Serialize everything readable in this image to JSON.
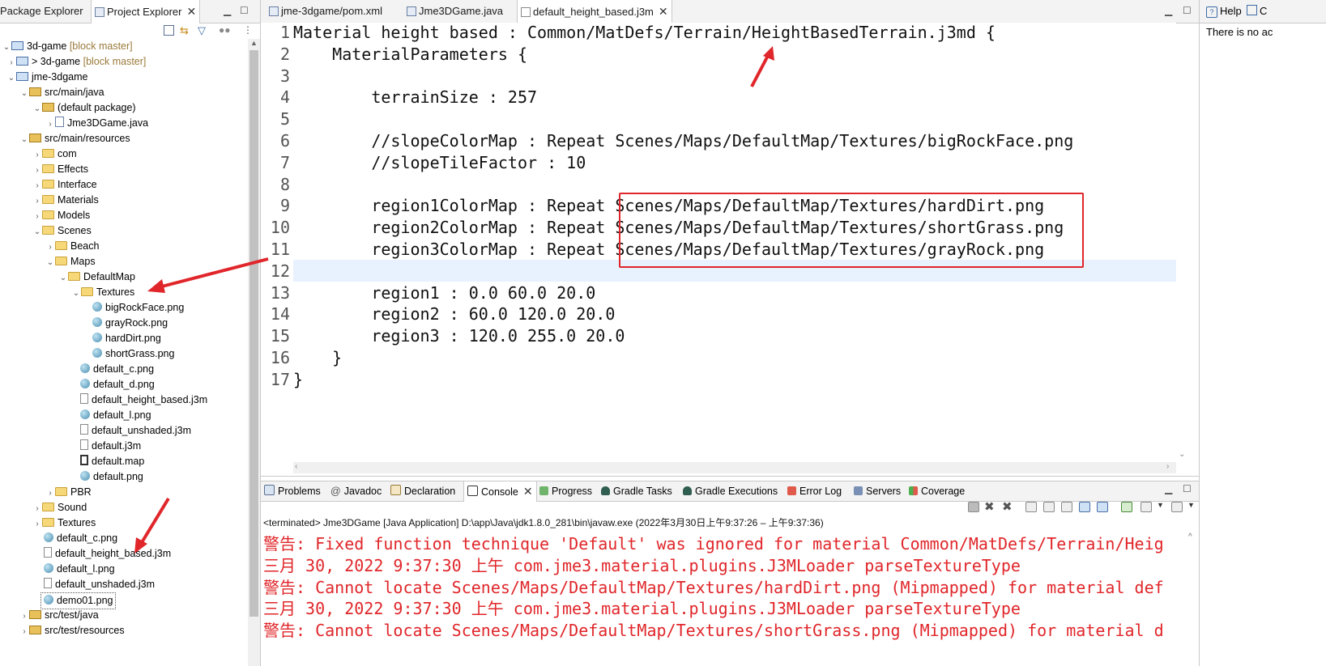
{
  "left_tabs": {
    "package_explorer": "Package Explorer",
    "project_explorer": "Project Explorer"
  },
  "editor_tabs": [
    {
      "label": "jme-3dgame/pom.xml"
    },
    {
      "label": "Jme3DGame.java"
    },
    {
      "label": "default_height_based.j3m"
    }
  ],
  "right_panel": {
    "tab": "Help",
    "tab2": "C",
    "text": "There is no ac"
  },
  "tree": [
    {
      "label": "3d-game",
      "deco": "[block master]"
    },
    {
      "label": "> 3d-game",
      "deco": "[block master]"
    },
    {
      "label": "jme-3dgame",
      "deco": ""
    },
    {
      "label": "src/main/java",
      "deco": ""
    },
    {
      "label": "(default package)",
      "deco": ""
    },
    {
      "label": "Jme3DGame.java",
      "deco": ""
    },
    {
      "label": "src/main/resources",
      "deco": ""
    },
    {
      "label": "com",
      "deco": ""
    },
    {
      "label": "Effects",
      "deco": ""
    },
    {
      "label": "Interface",
      "deco": ""
    },
    {
      "label": "Materials",
      "deco": ""
    },
    {
      "label": "Models",
      "deco": ""
    },
    {
      "label": "Scenes",
      "deco": ""
    },
    {
      "label": "Beach",
      "deco": ""
    },
    {
      "label": "Maps",
      "deco": ""
    },
    {
      "label": "DefaultMap",
      "deco": ""
    },
    {
      "label": "Textures",
      "deco": ""
    },
    {
      "label": "bigRockFace.png",
      "deco": ""
    },
    {
      "label": "grayRock.png",
      "deco": ""
    },
    {
      "label": "hardDirt.png",
      "deco": ""
    },
    {
      "label": "shortGrass.png",
      "deco": ""
    },
    {
      "label": "default_c.png",
      "deco": ""
    },
    {
      "label": "default_d.png",
      "deco": ""
    },
    {
      "label": "default_height_based.j3m",
      "deco": ""
    },
    {
      "label": "default_l.png",
      "deco": ""
    },
    {
      "label": "default_unshaded.j3m",
      "deco": ""
    },
    {
      "label": "default.j3m",
      "deco": ""
    },
    {
      "label": "default.map",
      "deco": ""
    },
    {
      "label": "default.png",
      "deco": ""
    },
    {
      "label": "PBR",
      "deco": ""
    },
    {
      "label": "Sound",
      "deco": ""
    },
    {
      "label": "Textures",
      "deco": ""
    },
    {
      "label": "default_c.png",
      "deco": ""
    },
    {
      "label": "default_height_based.j3m",
      "deco": ""
    },
    {
      "label": "default_l.png",
      "deco": ""
    },
    {
      "label": "default_unshaded.j3m",
      "deco": ""
    },
    {
      "label": "demo01.png",
      "deco": ""
    },
    {
      "label": "src/test/java",
      "deco": ""
    },
    {
      "label": "src/test/resources",
      "deco": ""
    }
  ],
  "code_lines": [
    {
      "n": "1",
      "text": "Material height based : Common/MatDefs/Terrain/HeightBasedTerrain.j3md {"
    },
    {
      "n": "2",
      "text": "    MaterialParameters {"
    },
    {
      "n": "3",
      "text": ""
    },
    {
      "n": "4",
      "text": "        terrainSize : 257"
    },
    {
      "n": "5",
      "text": ""
    },
    {
      "n": "6",
      "text": "        //slopeColorMap : Repeat Scenes/Maps/DefaultMap/Textures/bigRockFace.png"
    },
    {
      "n": "7",
      "text": "        //slopeTileFactor : 10"
    },
    {
      "n": "8",
      "text": ""
    },
    {
      "n": "9",
      "text": "        region1ColorMap : Repeat Scenes/Maps/DefaultMap/Textures/hardDirt.png"
    },
    {
      "n": "10",
      "text": "        region2ColorMap : Repeat Scenes/Maps/DefaultMap/Textures/shortGrass.png"
    },
    {
      "n": "11",
      "text": "        region3ColorMap : Repeat Scenes/Maps/DefaultMap/Textures/grayRock.png"
    },
    {
      "n": "12",
      "text": ""
    },
    {
      "n": "13",
      "text": "        region1 : 0.0 60.0 20.0"
    },
    {
      "n": "14",
      "text": "        region2 : 60.0 120.0 20.0"
    },
    {
      "n": "15",
      "text": "        region3 : 120.0 255.0 20.0"
    },
    {
      "n": "16",
      "text": "    }"
    },
    {
      "n": "17",
      "text": "}"
    }
  ],
  "bottom_tabs": [
    {
      "label": "Problems"
    },
    {
      "label": "Javadoc"
    },
    {
      "label": "Declaration"
    },
    {
      "label": "Console"
    },
    {
      "label": "Progress"
    },
    {
      "label": "Gradle Tasks"
    },
    {
      "label": "Gradle Executions"
    },
    {
      "label": "Error Log"
    },
    {
      "label": "Servers"
    },
    {
      "label": "Coverage"
    }
  ],
  "console": {
    "status": "<terminated> Jme3DGame [Java Application] D:\\app\\Java\\jdk1.8.0_281\\bin\\javaw.exe  (2022年3月30日上午9:37:26 – 上午9:37:36)",
    "lines": [
      "警告: Fixed function technique 'Default' was ignored for material Common/MatDefs/Terrain/Heig",
      "三月 30, 2022 9:37:30 上午 com.jme3.material.plugins.J3MLoader parseTextureType",
      "警告: Cannot locate Scenes/Maps/DefaultMap/Textures/hardDirt.png (Mipmapped) for material def",
      "三月 30, 2022 9:37:30 上午 com.jme3.material.plugins.J3MLoader parseTextureType",
      "警告: Cannot locate Scenes/Maps/DefaultMap/Textures/shortGrass.png (Mipmapped) for material d"
    ]
  },
  "colors": {
    "annotation_red": "#e0262a",
    "current_line": "#e8f2fe",
    "console_error": "#e0262a"
  }
}
